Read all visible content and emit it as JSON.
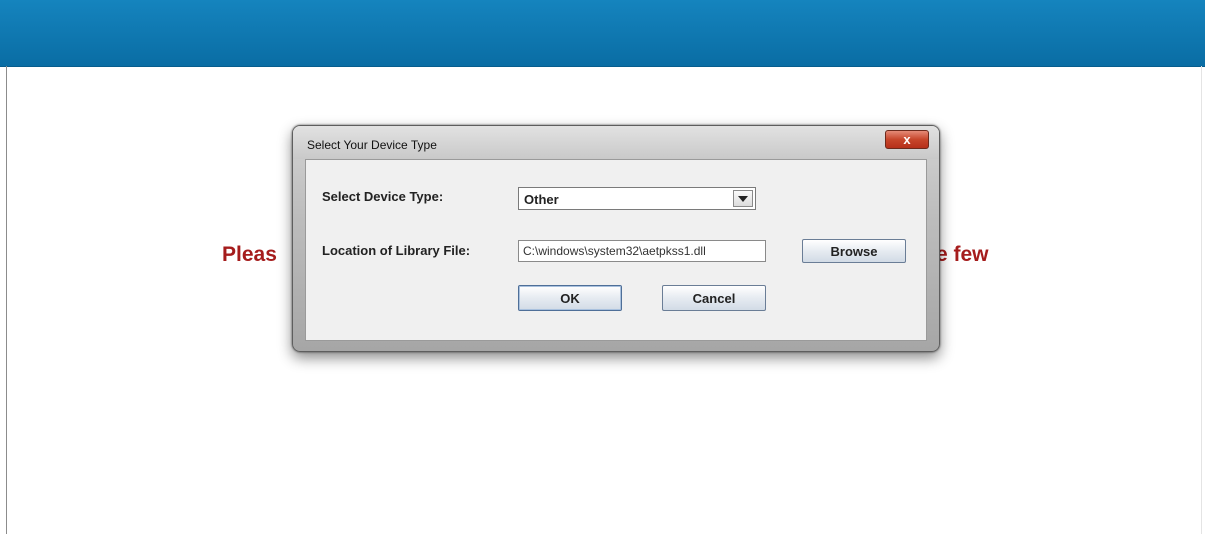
{
  "app": {
    "background_message_left": "Pleas",
    "background_message_right": "e few"
  },
  "dialog": {
    "title": "Select Your Device Type",
    "close_label": "x",
    "device_type_label": "Select Device Type:",
    "device_type_value": "Other",
    "library_location_label": "Location of Library File:",
    "library_location_value": "C:\\windows\\system32\\aetpkss1.dll",
    "browse_label": "Browse",
    "ok_label": "OK",
    "cancel_label": "Cancel"
  },
  "colors": {
    "header": "#0a6da4",
    "message": "#a51c1c"
  }
}
